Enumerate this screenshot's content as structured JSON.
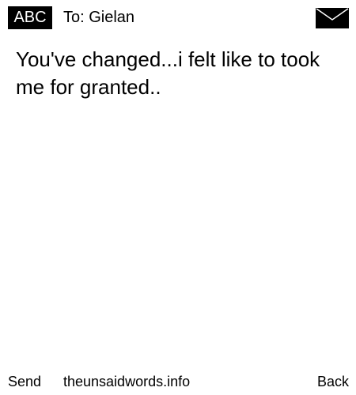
{
  "header": {
    "input_mode": "ABC",
    "recipient": "To: Gielan",
    "icon": "envelope-icon"
  },
  "message": {
    "text": "You've changed...i felt like to took me for granted.."
  },
  "footer": {
    "left_softkey": "Send",
    "site": "theunsaidwords.info",
    "right_softkey": "Back"
  },
  "colors": {
    "background": "#ffffff",
    "text": "#000000",
    "badge_bg": "#000000",
    "badge_text": "#ffffff"
  }
}
